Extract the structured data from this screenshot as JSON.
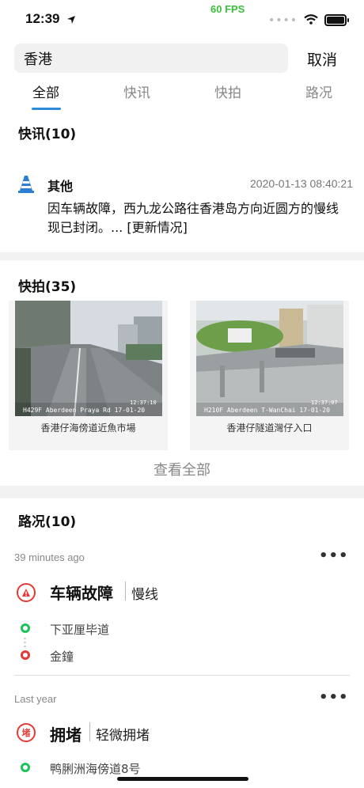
{
  "status": {
    "time": "12:39",
    "fps": "60 FPS"
  },
  "search": {
    "value": "香港",
    "cancel": "取消"
  },
  "tabs": [
    "全部",
    "快讯",
    "快拍",
    "路况"
  ],
  "news": {
    "title": "快讯(10)",
    "item": {
      "category": "其他",
      "time": "2020-01-13 08:40:21",
      "body": "因车辆故障，西九龙公路往香港岛方向近圆方的慢线现已封闭。... [更新情况]"
    }
  },
  "photos": {
    "title": "快拍(35)",
    "items": [
      {
        "caption": "香港仔海傍道近魚市場",
        "overlay": "H429F Aberdeen Praya Rd 17-01-20",
        "clock": "12:37:10"
      },
      {
        "caption": "香港仔隧道灣仔入口",
        "overlay": "H210F Aberdeen T-WanChai 17-01-20",
        "clock": "12:37:07"
      }
    ],
    "view_all": "查看全部"
  },
  "road": {
    "title": "路况(10)",
    "items": [
      {
        "ago": "39 minutes ago",
        "title": "车辆故障",
        "sub": "慢线",
        "from": "下亚厘毕道",
        "to": "金鐘",
        "icon": "warning-icon",
        "color": "#e53935"
      },
      {
        "ago": "Last year",
        "title": "拥堵",
        "sub": "轻微拥堵",
        "from": "鸭脷洲海傍道8号",
        "icon_text": "堵",
        "icon": "congestion-icon",
        "color": "#e53935"
      }
    ],
    "more_label": "•••"
  },
  "colors": {
    "accent": "#2d8bd9",
    "green": "#1cc35a",
    "red": "#e53935"
  }
}
